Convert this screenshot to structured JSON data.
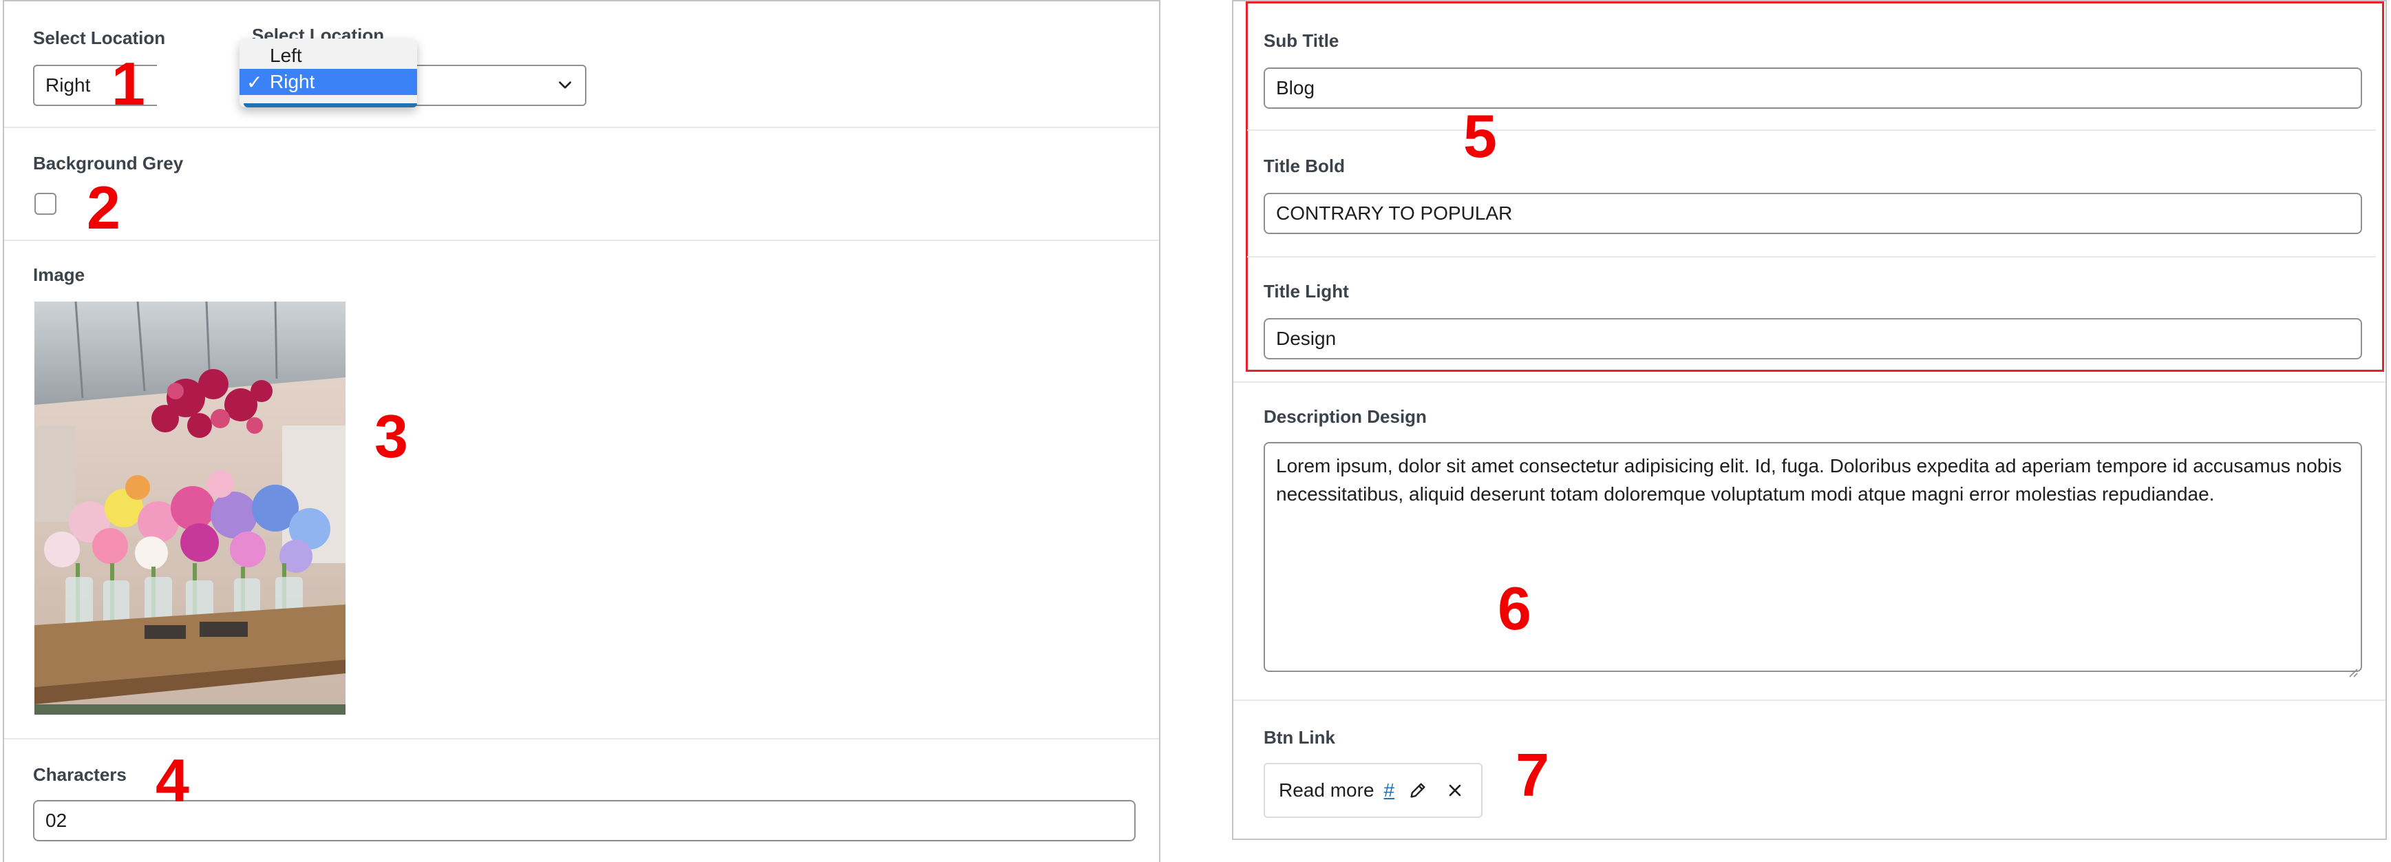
{
  "colors": {
    "annotation_red": "#f10000",
    "highlight_border": "#e3242b",
    "link_blue": "#2271b1",
    "dropdown_selected": "#3a82f6"
  },
  "left": {
    "select_location": {
      "label": "Select Location",
      "value": "Right",
      "overlay_label": "Select Location",
      "options": [
        "Left",
        "Right"
      ],
      "selected_check": "✓",
      "chevron_icon": "chevron-down-icon"
    },
    "background_grey": {
      "label": "Background Grey",
      "checked": false
    },
    "image": {
      "label": "Image"
    },
    "characters": {
      "label": "Characters",
      "value": "02"
    }
  },
  "right": {
    "sub_title": {
      "label": "Sub Title",
      "value": "Blog"
    },
    "title_bold": {
      "label": "Title Bold",
      "value": "CONTRARY TO POPULAR"
    },
    "title_light": {
      "label": "Title Light",
      "value": "Design"
    },
    "description_design": {
      "label": "Description Design",
      "value": "Lorem ipsum, dolor sit amet consectetur adipisicing elit. Id, fuga. Doloribus expedita ad aperiam tempore id accusamus nobis necessitatibus, aliquid deserunt totam doloremque voluptatum modi atque magni error molestias repudiandae."
    },
    "btn_link": {
      "label": "Btn Link",
      "text": "Read more",
      "url": "#",
      "edit_icon": "pencil-icon",
      "remove_icon": "close-icon"
    }
  },
  "annotations": [
    "1",
    "2",
    "3",
    "4",
    "5",
    "6",
    "7"
  ]
}
